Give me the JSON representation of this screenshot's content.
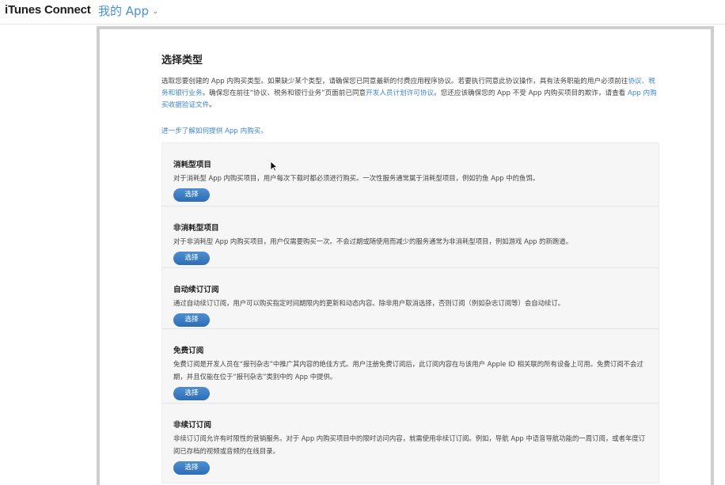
{
  "header": {
    "brand": "iTunes Connect",
    "app_menu": "我的 App",
    "app_menu_chevron": "⌄"
  },
  "main": {
    "title": "选择类型",
    "intro": {
      "p1": "选取您要创建的 App 内购买类型。如果缺少某个类型，请确保您已同意最新的付费应用程序协议。若要执行同意此协议操作，具有法务职能的用户必须前往",
      "link1": "协议、税务和银行业务",
      "p2": "。确保您在前往“协议、税务和银行业务”页面前已同意",
      "link2": "开发人员计划许可协议",
      "p3": "。您还应该确保您的 App 不受 App 内购买项目的欺诈，请查看 ",
      "link3": "App 内购买收据验证文件",
      "p4": "。"
    },
    "learn_more": "进一步了解如何提供 App 内购买。",
    "types": [
      {
        "name": "消耗型项目",
        "desc": "对于消耗型 App 内购买项目，用户每次下载时都必须进行购买。一次性服务通常属于消耗型项目，例如钓鱼 App 中的鱼饵。",
        "button": "选择"
      },
      {
        "name": "非消耗型项目",
        "desc": "对于非消耗型 App 内购买项目，用户仅需要购买一次。不会过期或随使用而减少的服务通常为非消耗型项目，例如游戏 App 的新跑道。",
        "button": "选择"
      },
      {
        "name": "自动续订订阅",
        "desc": "通过自动续订订阅，用户可以购买指定时间期限内的更新和动态内容。除非用户取消选择，否则订阅（例如杂志订阅等）会自动续订。",
        "button": "选择"
      },
      {
        "name": "免费订阅",
        "desc": "免费订阅是开发人员在“报刊杂志”中推广其内容的绝佳方式。用户注册免费订阅后，此订阅内容在与该用户 Apple ID 相关联的所有设备上可用。免费订阅不会过期，并且仅能在位于“报刊杂志”类别中的 App 中提供。",
        "button": "选择"
      },
      {
        "name": "非续订订阅",
        "desc": "非续订订阅允许有时限性的营销服务。对于 App 内购买项目中的限时访问内容，就需使用非续订订阅。例如，导航 App 中语音导航功能的一周订阅，或者年度订阅已存档的视频或音频的在线目录。",
        "button": "选择"
      }
    ]
  },
  "colors": {
    "accent": "#3b84d2",
    "button": "#2c6db5"
  }
}
